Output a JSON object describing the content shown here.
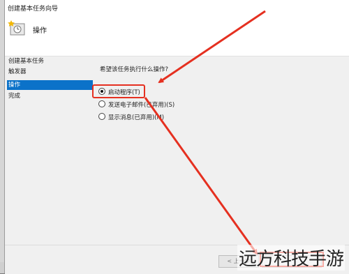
{
  "window": {
    "title": "创建基本任务向导"
  },
  "header": {
    "title": "操作"
  },
  "steps": [
    "创建基本任务",
    "触发器",
    "操作",
    "完成"
  ],
  "active_step": 2,
  "main": {
    "prompt": "希望该任务执行什么操作?",
    "options": [
      {
        "label": "启动程序(T)",
        "checked": true
      },
      {
        "label": "发送电子邮件(已弃用)(S)",
        "checked": false
      },
      {
        "label": "显示消息(已弃用)(M)",
        "checked": false
      }
    ]
  },
  "footer": {
    "back_label": "< 上一步"
  },
  "watermark": "远方科技手游",
  "colors": {
    "annotation": "#e53020",
    "selection": "#0b72c9"
  }
}
